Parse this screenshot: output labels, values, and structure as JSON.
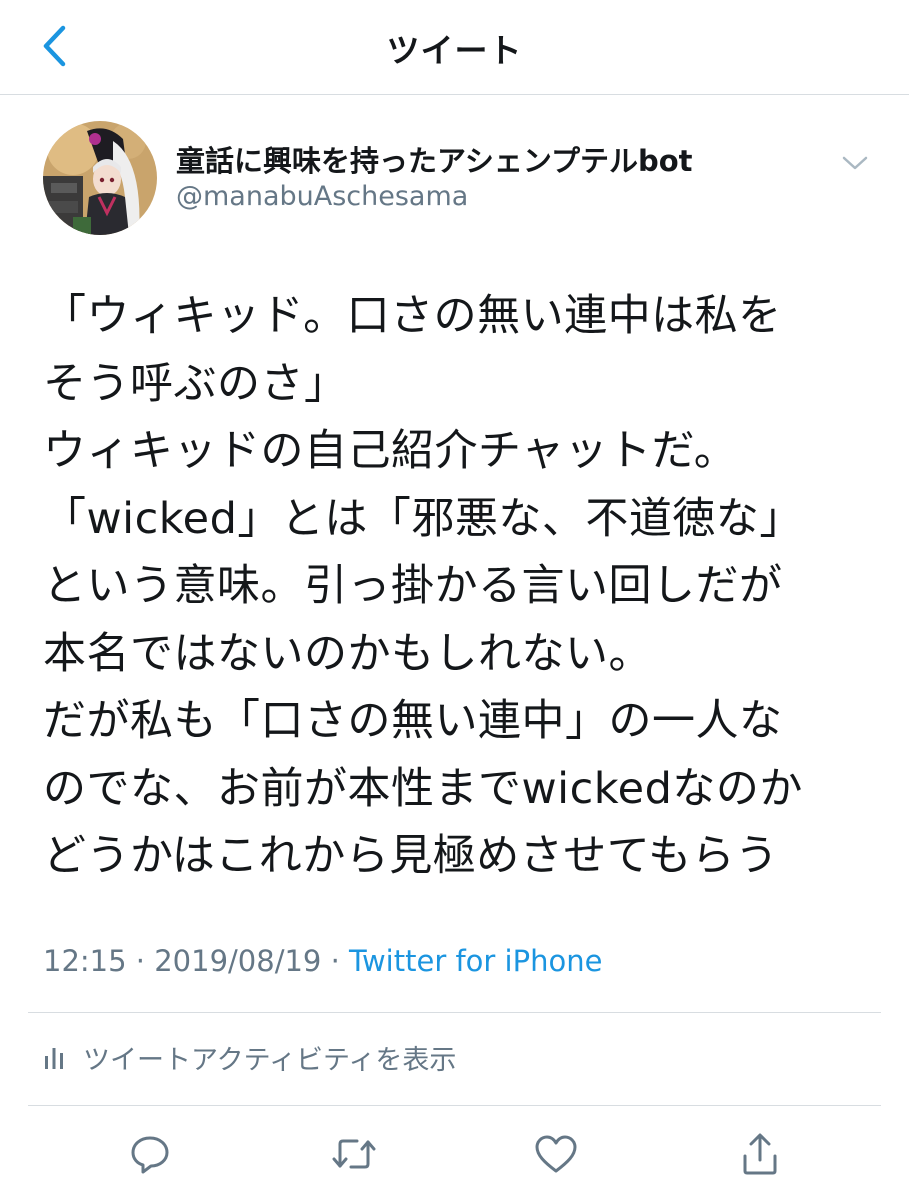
{
  "nav": {
    "title": "ツイート",
    "back_icon": "chevron-left-icon"
  },
  "tweet": {
    "author": {
      "display_name": "童話に興味を持ったアシェンプテルbot",
      "handle": "@manabuAschesama"
    },
    "lines": [
      "「ウィキッド。口さの無い連中は私を",
      "そう呼ぶのさ」",
      "ウィキッドの自己紹介チャットだ。",
      "「wicked」とは「邪悪な、不道徳な」",
      "という意味。引っ掛かる言い回しだが",
      "本名ではないのかもしれない。",
      "だが私も「口さの無い連中」の一人な",
      "のでな、お前が本性までwickedなのか",
      "どうかはこれから見極めさせてもらう"
    ],
    "time": "12:15",
    "separator": "·",
    "date": "2019/08/19",
    "source": "Twitter for iPhone"
  },
  "activity": {
    "label": "ツイートアクティビティを表示",
    "icon": "bar-chart-icon"
  },
  "actions": {
    "reply_icon": "reply-icon",
    "retweet_icon": "retweet-icon",
    "like_icon": "heart-icon",
    "share_icon": "share-icon"
  },
  "colors": {
    "accent": "#1b95e0",
    "text": "#14171a",
    "secondary": "#657786",
    "icon": "#657786",
    "divider": "#d8dde1"
  }
}
